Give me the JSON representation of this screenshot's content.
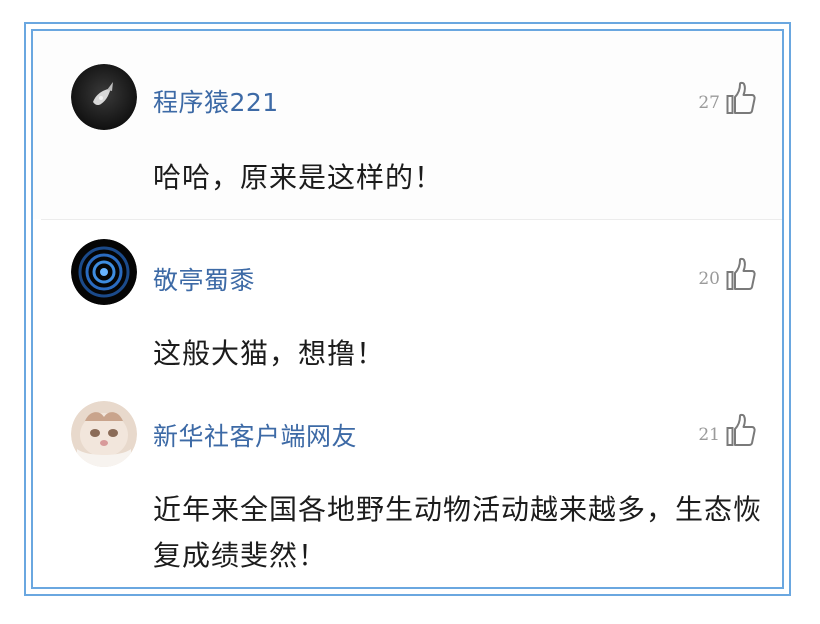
{
  "comments": [
    {
      "username": "程序猿221",
      "likes": "27",
      "text": "哈哈，原来是这样的！"
    },
    {
      "username": "敬亭蜀黍",
      "likes": "20",
      "text": "这般大猫，想撸！"
    },
    {
      "username": "新华社客户端网友",
      "likes": "21",
      "text": "近年来全国各地野生动物活动越来越多，生态恢复成绩斐然！"
    }
  ],
  "icons": {
    "like": "thumbs-up-icon"
  },
  "colors": {
    "frame_border": "#6aa7e0",
    "username": "#3d6aa6",
    "like_count": "#9a9a9a",
    "comment_text": "#1c1c1c"
  }
}
